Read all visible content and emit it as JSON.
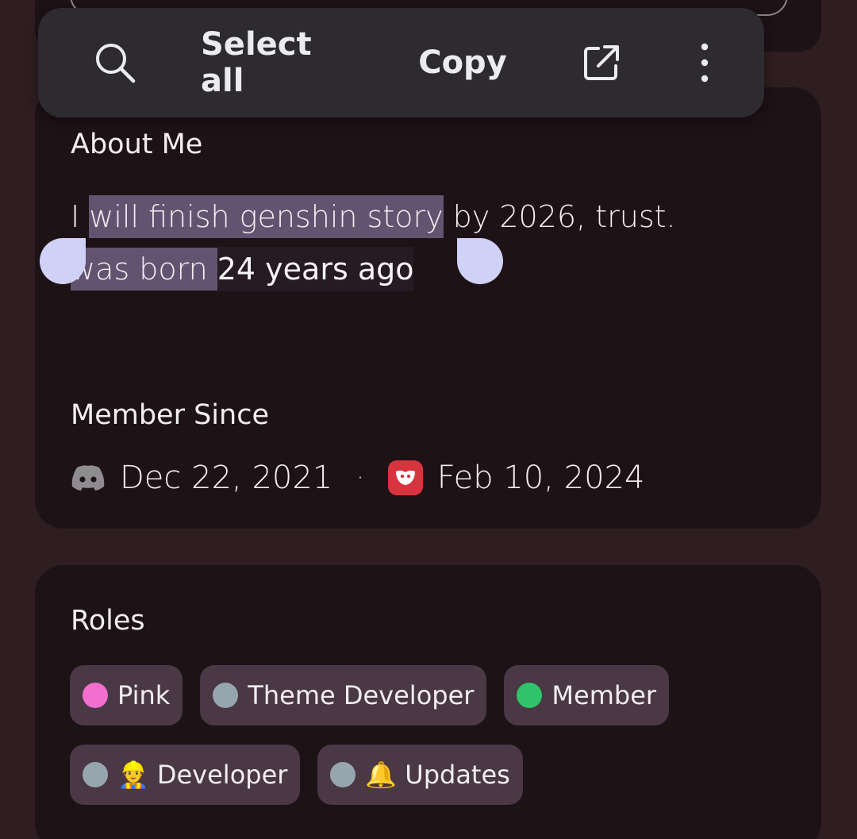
{
  "toolbar": {
    "search_icon": "search-icon",
    "select_all": "Select all",
    "copy": "Copy",
    "open_icon": "open-external-icon",
    "more_icon": "more-vertical-icon"
  },
  "about": {
    "title": "About Me",
    "line1_pre": "I ",
    "line1_selected": "will finish genshin story",
    "line1_post": " by 2026, trust.",
    "line2_selected": "was born ",
    "line2_highlight": "24 years ago"
  },
  "member_since": {
    "title": "Member Since",
    "discord_date": "Dec 22, 2021",
    "separator": "·",
    "app_date": "Feb 10, 2024"
  },
  "roles": {
    "title": "Roles",
    "items": [
      {
        "label": "Pink",
        "color": "#f26fd0",
        "emoji": ""
      },
      {
        "label": "Theme Developer",
        "color": "#97a6ae",
        "emoji": ""
      },
      {
        "label": "Member",
        "color": "#2fc46a",
        "emoji": ""
      },
      {
        "label": "Developer",
        "color": "#97a6ae",
        "emoji": "👷"
      },
      {
        "label": "Updates",
        "color": "#97a6ae",
        "emoji": "🔔"
      }
    ]
  },
  "colors": {
    "background": "#2e1d21",
    "card": "#1d1216",
    "chip": "#4a3844",
    "selection": "#625470",
    "handle": "#cfd1f7",
    "toolbar": "#2d2b30"
  }
}
